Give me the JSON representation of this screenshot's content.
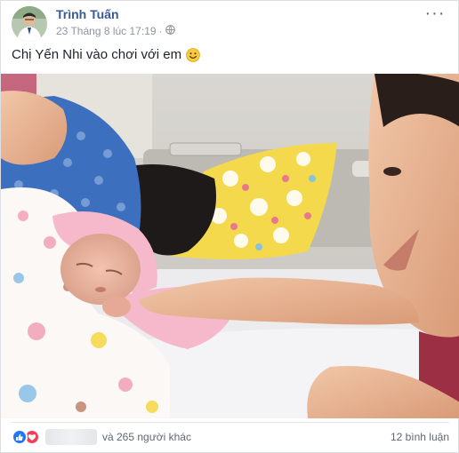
{
  "post": {
    "author": "Trình Tuấn",
    "timestamp": "23 Tháng 8 lúc 17:19",
    "separator": "·",
    "privacy_icon": "globe-icon",
    "more_label": "···",
    "caption_text": "Chị Yến Nhi vào chơi với em",
    "caption_emoji": "smile-emoji"
  },
  "footer": {
    "reaction_icons": [
      "like-icon",
      "love-icon"
    ],
    "reaction_text": "và 265 người khác",
    "comments_text": "12 bình luận"
  },
  "colors": {
    "author_link": "#385898",
    "meta_gray": "#90949c",
    "like_blue": "#2078f4",
    "love_red": "#f33e58"
  }
}
